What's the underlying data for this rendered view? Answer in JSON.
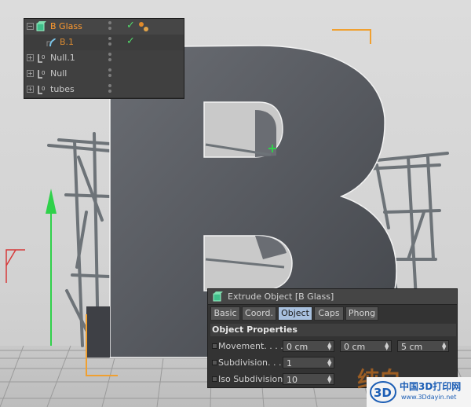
{
  "object_manager": {
    "objects": [
      {
        "name": "B Glass",
        "selected": true,
        "expander": "−"
      },
      {
        "name": "B.1",
        "selected": true
      },
      {
        "name": "Null.1",
        "expander": "+"
      },
      {
        "name": "Null",
        "expander": "+"
      },
      {
        "name": "tubes",
        "expander": "+"
      }
    ],
    "icons": [
      "extrude-object-icon",
      "spline-icon",
      "null-object-icon",
      "material-tag-icon"
    ],
    "check_glyph": "✓"
  },
  "attribute_manager": {
    "title": "Extrude Object [B Glass]",
    "tabs": [
      {
        "label": "Basic",
        "active": false
      },
      {
        "label": "Coord.",
        "active": false
      },
      {
        "label": "Object",
        "active": true
      },
      {
        "label": "Caps",
        "active": false
      },
      {
        "label": "Phong",
        "active": false
      }
    ],
    "section": "Object Properties",
    "properties": {
      "movement": {
        "label": "Movement. . . .",
        "x": "0 cm",
        "y": "0 cm",
        "z": "5 cm"
      },
      "subdivision": {
        "label": "Subdivision. . .",
        "value": "1"
      },
      "iso_subdivision": {
        "label": "Iso Subdivision",
        "value": "10"
      }
    }
  },
  "watermark": {
    "title": "中国3D打印网",
    "url": "www.3Ddayin.net",
    "logo_text": "3D",
    "overlay_text": "纯白"
  },
  "colors": {
    "accent_orange": "#ff9a2e",
    "selection_blue": "#a8c0de",
    "axis_green": "#2fd14a",
    "axis_red": "#d63a3a",
    "letter_gray": "#55585e",
    "check_green": "#52d86a"
  }
}
